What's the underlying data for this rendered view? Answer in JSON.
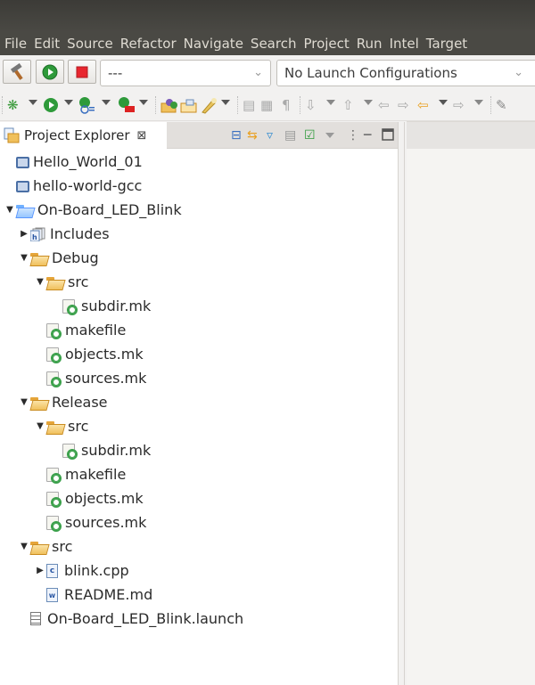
{
  "menu": [
    "File",
    "Edit",
    "Source",
    "Refactor",
    "Navigate",
    "Search",
    "Project",
    "Run",
    "Intel",
    "Target"
  ],
  "toolbar": {
    "build_icon": "hammer-icon",
    "run_icon": "play-icon",
    "stop_icon": "stop-icon",
    "launch_mode_value": "---",
    "launch_config_value": "No Launch Configurations"
  },
  "panel": {
    "title": "Project Explorer",
    "close_glyph": "⊠"
  },
  "tree": [
    {
      "label": "Hello_World_01",
      "icon": "project-closed",
      "depth": 0,
      "arrow": ""
    },
    {
      "label": "hello-world-gcc",
      "icon": "project-closed",
      "depth": 0,
      "arrow": ""
    },
    {
      "label": "On-Board_LED_Blink",
      "icon": "project-open",
      "depth": 0,
      "arrow": "expanded"
    },
    {
      "label": "Includes",
      "icon": "includes",
      "depth": 1,
      "arrow": "collapsed"
    },
    {
      "label": "Debug",
      "icon": "folder-open",
      "depth": 1,
      "arrow": "expanded"
    },
    {
      "label": "src",
      "icon": "folder-open",
      "depth": 2,
      "arrow": "expanded"
    },
    {
      "label": "subdir.mk",
      "icon": "makefile",
      "depth": 3,
      "arrow": ""
    },
    {
      "label": "makefile",
      "icon": "makefile",
      "depth": 2,
      "arrow": ""
    },
    {
      "label": "objects.mk",
      "icon": "makefile",
      "depth": 2,
      "arrow": ""
    },
    {
      "label": "sources.mk",
      "icon": "makefile",
      "depth": 2,
      "arrow": ""
    },
    {
      "label": "Release",
      "icon": "folder-open",
      "depth": 1,
      "arrow": "expanded"
    },
    {
      "label": "src",
      "icon": "folder-open",
      "depth": 2,
      "arrow": "expanded"
    },
    {
      "label": "subdir.mk",
      "icon": "makefile",
      "depth": 3,
      "arrow": ""
    },
    {
      "label": "makefile",
      "icon": "makefile",
      "depth": 2,
      "arrow": ""
    },
    {
      "label": "objects.mk",
      "icon": "makefile",
      "depth": 2,
      "arrow": ""
    },
    {
      "label": "sources.mk",
      "icon": "makefile",
      "depth": 2,
      "arrow": ""
    },
    {
      "label": "src",
      "icon": "folder-open",
      "depth": 1,
      "arrow": "expanded"
    },
    {
      "label": "blink.cpp",
      "icon": "cpp-file",
      "depth": 2,
      "arrow": "collapsed"
    },
    {
      "label": "README.md",
      "icon": "text-file",
      "depth": 2,
      "arrow": ""
    },
    {
      "label": "On-Board_LED_Blink.launch",
      "icon": "launch-file",
      "depth": 1,
      "arrow": ""
    }
  ]
}
